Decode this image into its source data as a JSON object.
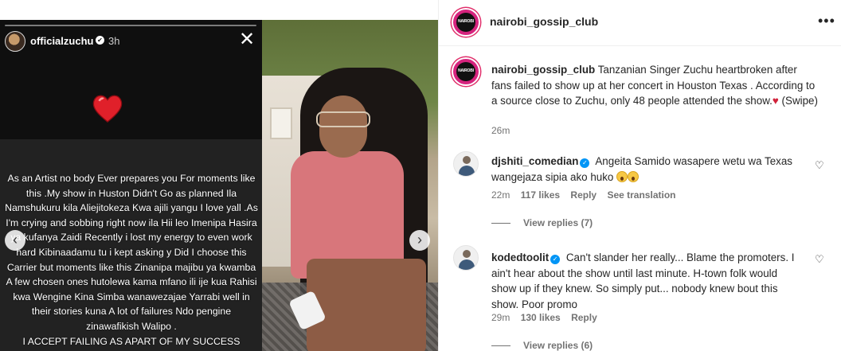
{
  "story": {
    "username": "officialzuchu",
    "verified_glyph": "✔",
    "time": "3h",
    "close_glyph": "✕",
    "text": "As an Artist no body Ever prepares you For moments like this .My show in Huston Didn't Go as planned Ila Namshukuru kila Aliejitokeza Kwa ajili yangu I love yall .As I'm crying and sobbing right now ila Hii leo Imenipa Hasira ya kufanya Zaidi Recently i lost my energy to even work hard Kibinaadamu tu i kept asking y Did I choose this Carrier but moments like this Zinanipa majibu ya kwamba A few chosen ones hutolewa kama mfano ili ije kua Rahisi kwa Wengine Kina Simba wanawezajae Yarrabi well in their stories kuna A lot of failures Ndo pengine  zinawafikish Walipo .",
    "text_last_line": "I ACCEPT FAILING AS APART OF MY SUCCESS",
    "heart_icon": "red-heart"
  },
  "media_nav": {
    "prev_glyph": "‹",
    "next_glyph": "›"
  },
  "post": {
    "author": "nairobi_gossip_club",
    "avatar_text": "NAIROBI",
    "more_glyph": "•••",
    "caption": "Tanzanian Singer Zuchu heartbroken after fans failed to show up at her concert in Houston Texas . According to a source close to Zuchu, only 48 people attended the show.",
    "caption_heart": "♥",
    "caption_suffix": "(Swipe)",
    "time": "26m"
  },
  "comments": [
    {
      "username": "djshiti_comedian",
      "text": "Angeita Samido wasapere wetu wa Texas wangejaza sipia ako huko",
      "time": "22m",
      "likes": "117 likes",
      "reply": "Reply",
      "translate": "See translation",
      "view_replies": "View replies (7)"
    },
    {
      "username": "kodedtoolit",
      "text": "Can't slander her really... Blame the promoters. I ain't hear about the show until last minute. H-town folk would show up if they knew. So simply put... nobody knew bout this show. Poor promo",
      "time": "29m",
      "likes": "130 likes",
      "reply": "Reply",
      "view_replies": "View replies (6)"
    }
  ],
  "like_glyph": "♡",
  "colors": {
    "accent_blue": "#0095f6",
    "heart_red": "#d1223b",
    "muted": "#737373"
  }
}
